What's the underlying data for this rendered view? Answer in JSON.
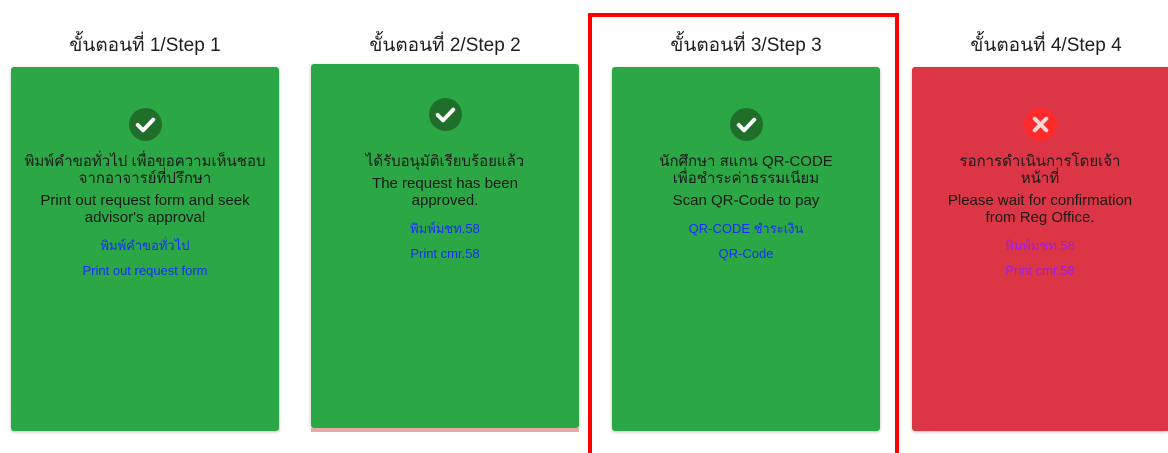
{
  "steps": [
    {
      "title": "ขั้นตอนที่ 1/Step 1",
      "status_icon": "check-circle-icon",
      "color": "#2ba745",
      "text_th": "พิมพ์คำขอทั่วไป เพื่อขอความเห็นชอบจากอาจารย์ที่ปรึกษา",
      "text_en": "Print out request form and seek advisor's approval",
      "link_th": "พิมพ์คำขอทั่วไป",
      "link_en": "Print out request form"
    },
    {
      "title": "ขั้นตอนที่ 2/Step 2",
      "status_icon": "check-circle-icon",
      "color": "#2ba745",
      "text_th": "ได้รับอนุมัติเรียบร้อยแล้ว",
      "text_en": "The request has been approved.",
      "link_th": "พิมพ์มชท.58",
      "link_en": "Print cmr.58"
    },
    {
      "title": "ขั้นตอนที่ 3/Step 3",
      "status_icon": "check-circle-icon",
      "color": "#2ba745",
      "text_th": "นักศึกษา สแกน QR-CODE เพื่อชำระค่าธรรมเนียม",
      "text_en": "Scan QR-Code to pay",
      "link_th": "QR-CODE ชำระเงิน",
      "link_en": "QR-Code"
    },
    {
      "title": "ขั้นตอนที่ 4/Step 4",
      "status_icon": "times-circle-icon",
      "color": "#dc3545",
      "text_th": "รอการดำเนินการโดยเจ้าหน้าที่",
      "text_en": "Please wait for confirmation from Reg Office.",
      "link_th": "พิมพ์มชท.58",
      "link_en": "Print cmr.58"
    }
  ],
  "highlight_color": "#ff0000"
}
